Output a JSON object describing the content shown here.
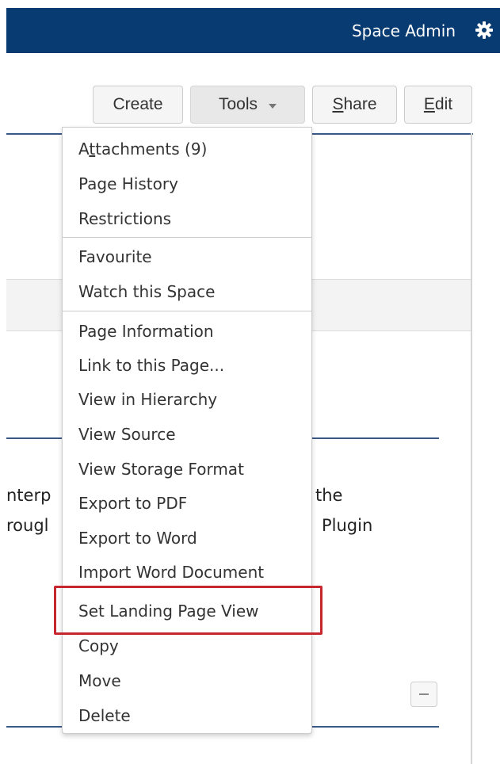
{
  "header": {
    "space_admin": "Space Admin",
    "gear_icon": "gear-icon"
  },
  "toolbar": {
    "create": "Create",
    "tools": "Tools",
    "share": {
      "accel": "S",
      "rest": "hare"
    },
    "edit": {
      "accel": "E",
      "rest": "dit"
    }
  },
  "background_text": {
    "left_line1": "nterp",
    "left_line2": "rougl",
    "right_line1": "the",
    "right_line2": "Plugin"
  },
  "menu": {
    "attachments": {
      "pre": "A",
      "accel": "t",
      "post": "tachments (9)"
    },
    "groups": [
      [
        "Page History",
        "Restrictions"
      ],
      [
        "Favourite",
        "Watch this Space"
      ],
      [
        "Page Information",
        "Link to this Page...",
        "View in Hierarchy",
        "View Source",
        "View Storage Format",
        "Export to PDF",
        "Export to Word",
        "Import Word Document",
        "Set Landing Page View",
        "Copy",
        "Move",
        "Delete"
      ]
    ],
    "highlighted": "Set Landing Page View",
    "highlight_color": "#c6262e"
  },
  "colors": {
    "header_bg": "#073b71",
    "rule": "#3a5a86"
  }
}
